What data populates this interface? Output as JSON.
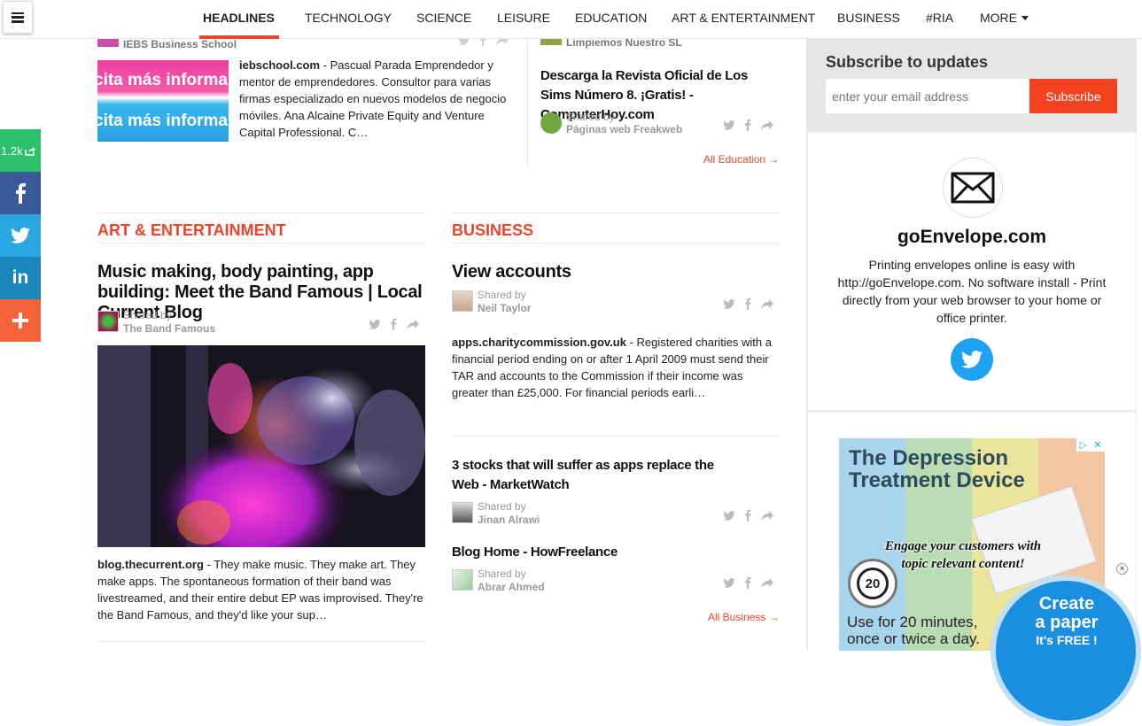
{
  "nav": {
    "items": [
      "HEADLINES",
      "TECHNOLOGY",
      "SCIENCE",
      "LEISURE",
      "EDUCATION",
      "ART & ENTERTAINMENT",
      "BUSINESS",
      "#RIA",
      "MORE"
    ]
  },
  "share": {
    "count": "1.2k",
    "colors": {
      "count": "#2ebf6c",
      "facebook": "#3b5998",
      "twitter": "#2aa7e0",
      "linkedin": "#1b86bc",
      "more": "#f4623a"
    }
  },
  "top_left": {
    "source": "IEBS Business School",
    "image_text": "cita más informa",
    "domain": "iebschool.com",
    "description": " - Pascual Parada Emprendedor y mentor de emprendedores. Consultor para varias firmas especializado en nuevos modelos de negocio móviles. Ana Alcaine Private Equity and Venture Capital Professional. C…"
  },
  "top_right": {
    "source": "Limpiemos Nuestro SL",
    "headline": "Descarga la Revista Oficial de Los Sims Número 8. ¡Gratis! - ComputerHoy.com",
    "shared_by_label": "Shared by",
    "shared_by_name": "Páginas web Freakweb",
    "all_link": "All Education →"
  },
  "art": {
    "section_title": "ART & ENTERTAINMENT",
    "headline": "Music making, body painting, app building: Meet the Band Famous | Local Current Blog",
    "shared_by_label": "Shared by",
    "shared_by_name": "The Band Famous",
    "domain": "blog.thecurrent.org",
    "description": " - They make music. They make art. They make apps. The spontaneous formation of their band was livestreamed, and their entire debut EP was improvised. They're the Band Famous, and they'd like your sup…"
  },
  "business": {
    "section_title": "BUSINESS",
    "item1": {
      "headline": "View accounts",
      "shared_by_label": "Shared by",
      "shared_by_name": "Neil Taylor",
      "domain": "apps.charitycommission.gov.uk",
      "description": " - Registered charities with a financial period ending on or after 1 April 2009 must send their TAR and accounts to the Commission if their income was greater than £25,000. For financial periods earli…"
    },
    "item2": {
      "headline": "3 stocks that will suffer as apps replace the Web - MarketWatch",
      "shared_by_label": "Shared by",
      "shared_by_name": "Jinan Alrawi"
    },
    "item3": {
      "headline": "Blog Home - HowFreelance",
      "shared_by_label": "Shared by",
      "shared_by_name": "Abrar Ahmed"
    },
    "all_link": "All Business →"
  },
  "sidebar": {
    "subscribe_title": "Subscribe to updates",
    "email_placeholder": "enter your email address",
    "subscribe_button": "Subscribe",
    "promo_title": "goEnvelope.com",
    "promo_text": "Printing envelopes online is easy with http://goEnvelope.com. No software install - Print directly from your web browser to your home or office printer.",
    "ad": {
      "title": "The Depression Treatment Device",
      "overlay_text": "Engage your customers with topic relevant content!",
      "badge_number": "20",
      "bottom_text": "Use for 20 minutes, once or twice a day.",
      "create_line1": "Create",
      "create_line2": "a paper",
      "create_line3": "It's FREE !"
    }
  },
  "colors": {
    "accent": "#e8452c",
    "subscribe": "#f4411f",
    "twitter_circle": "#1da1f2",
    "create_blue": "#1a8fe0"
  }
}
